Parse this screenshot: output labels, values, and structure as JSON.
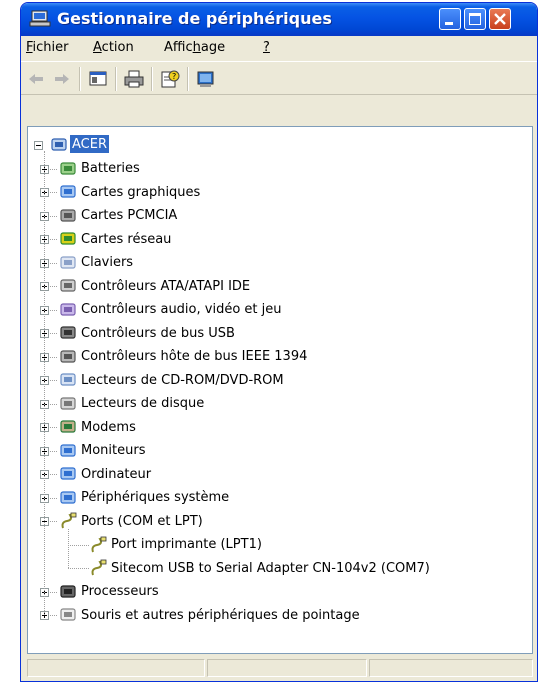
{
  "window": {
    "title": "Gestionnaire de périphériques",
    "buttons": [
      "minimize-icon",
      "maximize-icon",
      "close-icon"
    ]
  },
  "menu": [
    {
      "pre": "",
      "ul": "F",
      "post": "ichier"
    },
    {
      "pre": "",
      "ul": "A",
      "post": "ction"
    },
    {
      "pre": "Affic",
      "ul": "h",
      "post": "age"
    },
    {
      "pre": "",
      "ul": "?",
      "post": ""
    }
  ],
  "toolbar": {
    "buttons": [
      "back-arrow-icon",
      "forward-arrow-icon",
      "show-hide-tree-icon",
      "print-icon",
      "properties-icon",
      "scan-hardware-icon"
    ]
  },
  "tree": {
    "root": "ACER",
    "categories": [
      {
        "label": "Batteries",
        "icon": "battery-icon"
      },
      {
        "label": "Cartes graphiques",
        "icon": "display-adapter-icon"
      },
      {
        "label": "Cartes PCMCIA",
        "icon": "pcmcia-icon"
      },
      {
        "label": "Cartes réseau",
        "icon": "network-card-icon"
      },
      {
        "label": "Claviers",
        "icon": "keyboard-icon"
      },
      {
        "label": "Contrôleurs ATA/ATAPI IDE",
        "icon": "ide-controller-icon"
      },
      {
        "label": "Contrôleurs audio, vidéo et jeu",
        "icon": "audio-icon"
      },
      {
        "label": "Contrôleurs de bus USB",
        "icon": "usb-icon"
      },
      {
        "label": "Contrôleurs hôte de bus IEEE 1394",
        "icon": "ieee1394-icon"
      },
      {
        "label": "Lecteurs de CD-ROM/DVD-ROM",
        "icon": "cdrom-icon"
      },
      {
        "label": "Lecteurs de disque",
        "icon": "disk-drive-icon"
      },
      {
        "label": "Modems",
        "icon": "modem-icon"
      },
      {
        "label": "Moniteurs",
        "icon": "monitor-icon"
      },
      {
        "label": "Ordinateur",
        "icon": "computer-icon"
      },
      {
        "label": "Périphériques système",
        "icon": "system-device-icon"
      },
      {
        "label": "Ports (COM et LPT)",
        "icon": "port-icon",
        "expanded": true,
        "children": [
          "Port imprimante (LPT1)",
          "Sitecom USB to Serial Adapter CN-104v2 (COM7)"
        ]
      },
      {
        "label": "Processeurs",
        "icon": "processor-icon"
      },
      {
        "label": "Souris et autres périphériques de pointage",
        "icon": "mouse-icon"
      }
    ]
  },
  "colors": {
    "titlebar": "#0553e3",
    "selection": "#316ac5",
    "window_bg": "#ece9d8"
  }
}
